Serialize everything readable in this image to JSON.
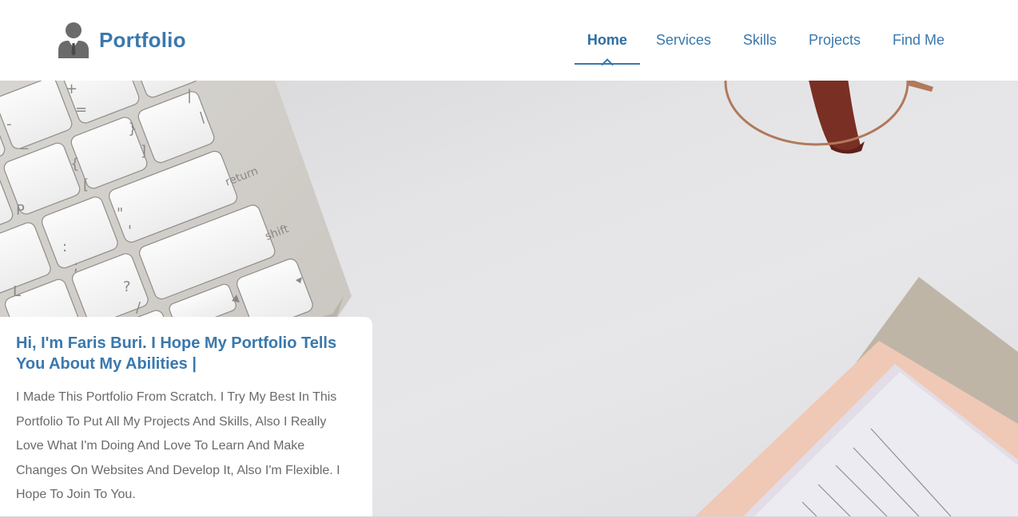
{
  "header": {
    "logo_text": "Portfolio",
    "nav": [
      {
        "label": "Home",
        "active": true
      },
      {
        "label": "Services",
        "active": false
      },
      {
        "label": "Skills",
        "active": false
      },
      {
        "label": "Projects",
        "active": false
      },
      {
        "label": "Find Me",
        "active": false
      }
    ]
  },
  "hero": {
    "image": "desk-flatlay-keyboard-glasses-notebook",
    "keyboard_keys": {
      "plus": "+",
      "equals": "=",
      "minus": "-",
      "underscore": "_",
      "pipe": "|",
      "backslash": "\\",
      "close_brace": "}",
      "close_bracket": "]",
      "open_brace": "{",
      "open_bracket": "[",
      "p": "P",
      "quote": "\"",
      "apostrophe": "'",
      "colon": ":",
      "semicolon": ";",
      "l": "L",
      "question": "?",
      "slash": "/",
      "return": "return",
      "shift": "shift"
    }
  },
  "intro": {
    "title": "Hi, I'm Faris Buri. I Hope My Portfolio Tells You About My Abilities |",
    "text": "I Made This Portfolio From Scratch. I Try My Best In This Portfolio To Put All My Projects And Skills, Also I Really Love What I'm Doing And Love To Learn And Make Changes On Websites And Develop It, Also I'm Flexible. I Hope To Join To You."
  },
  "colors": {
    "accent": "#3a78ad",
    "body_text": "#6a6a6a",
    "hero_background": "#e4e4e6"
  }
}
